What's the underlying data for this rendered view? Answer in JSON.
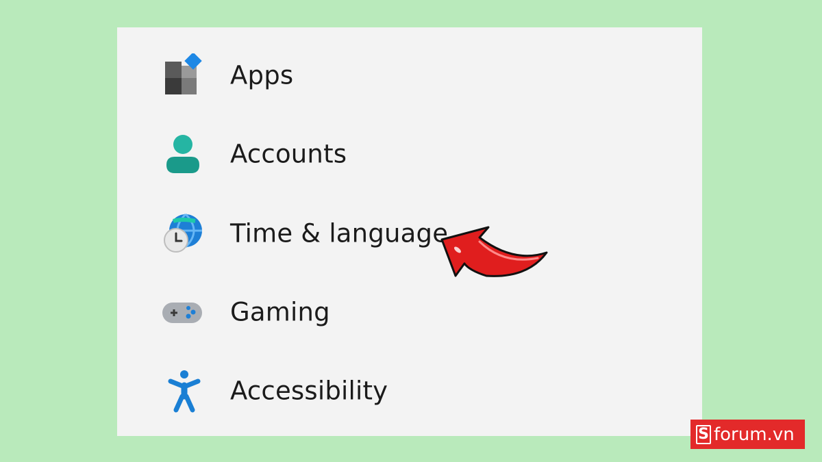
{
  "nav": {
    "items": [
      {
        "label": "Apps",
        "icon": "apps-icon"
      },
      {
        "label": "Accounts",
        "icon": "accounts-icon"
      },
      {
        "label": "Time & language",
        "icon": "time-language-icon"
      },
      {
        "label": "Gaming",
        "icon": "gaming-icon"
      },
      {
        "label": "Accessibility",
        "icon": "accessibility-icon"
      }
    ]
  },
  "annotation": {
    "icon": "red-arrow-icon",
    "color": "#e01e1e"
  },
  "watermark": {
    "logo_letter": "S",
    "text": "forum.vn",
    "color": "#e32a2a"
  },
  "colors": {
    "background": "#b9eabb",
    "panel": "#f3f3f3",
    "accent_teal": "#1ba89a",
    "accent_blue": "#1a7fd4"
  }
}
